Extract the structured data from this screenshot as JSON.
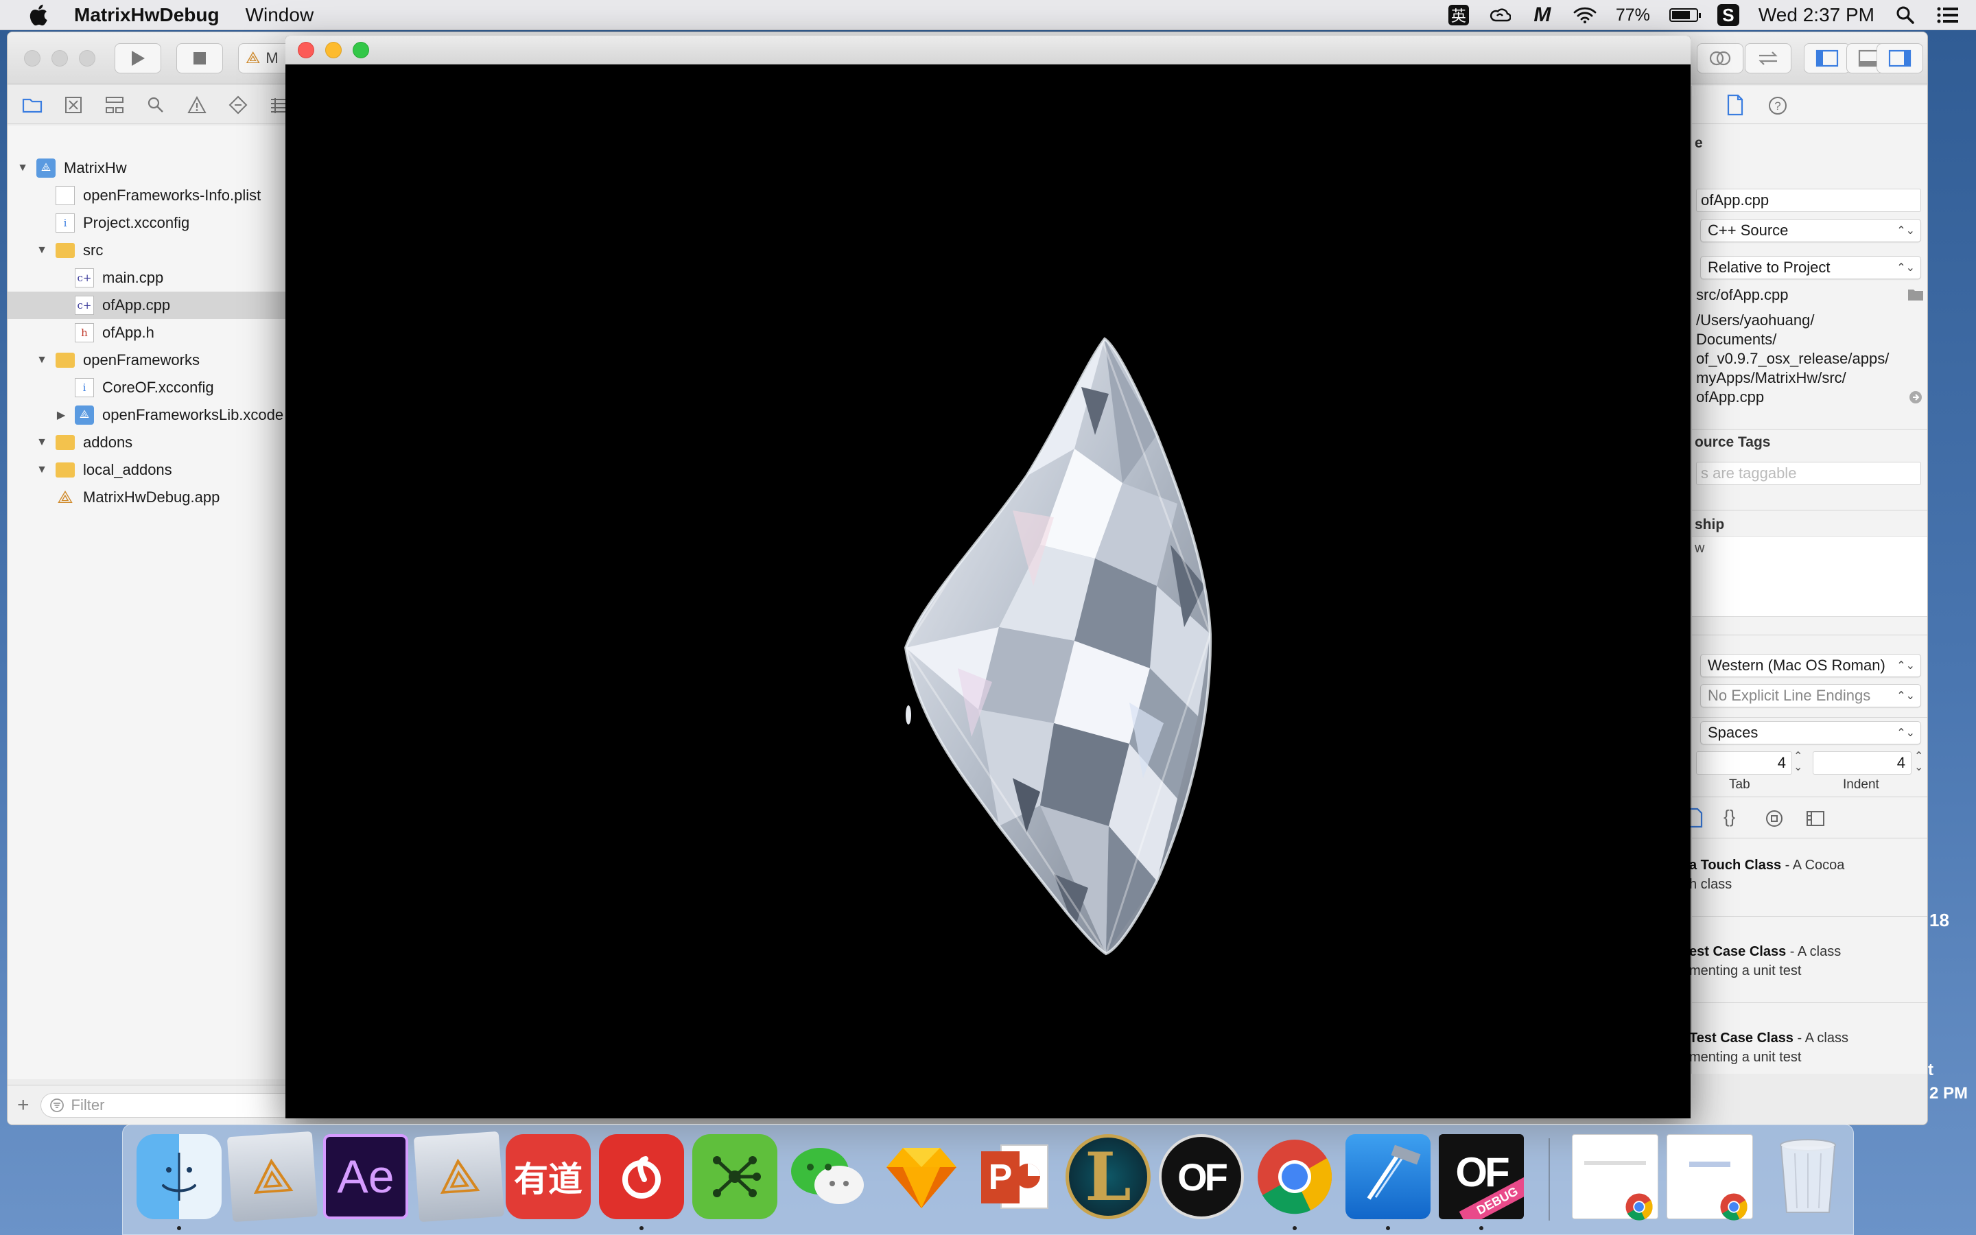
{
  "menubar": {
    "app_name": "MatrixHwDebug",
    "menu_items": [
      "Window"
    ],
    "ime_label": "英",
    "battery_percent_text": "77%",
    "battery_level": 0.77,
    "clock": "Wed 2:37 PM",
    "icons": [
      "apple-logo-icon",
      "ime-icon",
      "creative-cloud-icon",
      "m-app-icon",
      "wifi-icon",
      "battery-icon",
      "s-app-icon",
      "spotlight-search-icon",
      "notification-center-icon"
    ]
  },
  "xcode": {
    "scheme_label": "M",
    "navigator": {
      "items": [
        {
          "label": "MatrixHw",
          "type": "project",
          "expanded": true
        },
        {
          "label": "openFrameworks-Info.plist",
          "type": "file"
        },
        {
          "label": "Project.xcconfig",
          "type": "config"
        },
        {
          "label": "src",
          "type": "folder",
          "expanded": true
        },
        {
          "label": "main.cpp",
          "type": "cpp"
        },
        {
          "label": "ofApp.cpp",
          "type": "cpp",
          "selected": true
        },
        {
          "label": "ofApp.h",
          "type": "header"
        },
        {
          "label": "openFrameworks",
          "type": "folder",
          "expanded": true
        },
        {
          "label": "CoreOF.xcconfig",
          "type": "config"
        },
        {
          "label": "openFrameworksLib.xcode",
          "type": "project",
          "expanded": false
        },
        {
          "label": "addons",
          "type": "folder",
          "expanded": true
        },
        {
          "label": "local_addons",
          "type": "folder",
          "expanded": true
        },
        {
          "label": "MatrixHwDebug.app",
          "type": "app"
        }
      ],
      "filter_placeholder": "Filter"
    },
    "inspector": {
      "name_header": "e",
      "file_name": "ofApp.cpp",
      "file_type": "C++ Source",
      "location": "Relative to Project",
      "relative_path": "src/ofApp.cpp",
      "full_path_lines": [
        "/Users/yaohuang/",
        "Documents/",
        "of_v0.9.7_osx_release/apps/",
        "myApps/MatrixHw/src/",
        "ofApp.cpp"
      ],
      "on_demand_header": "ource Tags",
      "tags_placeholder": "s are taggable",
      "membership_header": "ship",
      "membership_text": "w",
      "text_encoding": "Western (Mac OS Roman)",
      "line_endings": "No Explicit Line Endings",
      "indent_using": "Spaces",
      "tab_width": "4",
      "indent_width": "4",
      "tab_label": "Tab",
      "indent_label": "Indent",
      "templates": [
        {
          "title": "a Touch Class",
          "desc_1": " - A Cocoa",
          "desc_2": "h class"
        },
        {
          "title": "est Case Class",
          "desc_1": " - A class",
          "desc_2": "menting a unit test"
        },
        {
          "title": "Test Case Class",
          "desc_1": " - A class",
          "desc_2": "menting a unit test"
        }
      ]
    }
  },
  "desktop_fragments": [
    "18",
    "t",
    "2 PM"
  ],
  "dock": {
    "apps": [
      "Finder",
      "Xcode Instruments",
      "Adobe After Effects",
      "Xcode Instruments",
      "Youdao Dictionary",
      "NetEase Music",
      "Mindnode",
      "WeChat",
      "Sketch",
      "PowerPoint",
      "League of Legends",
      "openFrameworks",
      "Google Chrome",
      "Xcode",
      "MatrixHwDebug"
    ],
    "ae_label": "Ae",
    "youdao_label": "有道",
    "ppt_label": "P",
    "of_label": "OF",
    "debug_badge": "DEBUG",
    "running_indices": [
      0,
      5,
      12,
      13,
      14
    ]
  }
}
